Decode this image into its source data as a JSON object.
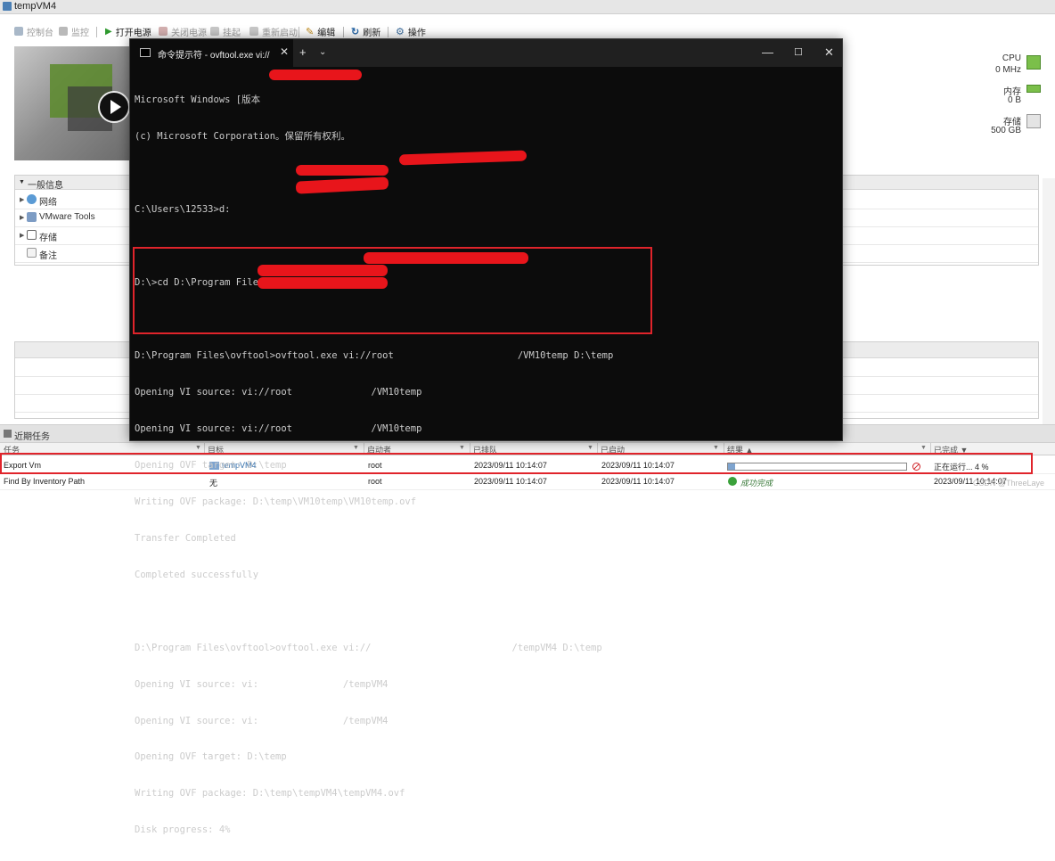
{
  "window": {
    "title": "tempVM4"
  },
  "toolbar": {
    "console": "控制台",
    "monitor": "监控",
    "power_on": "打开电源",
    "power_off": "关闭电源",
    "suspend": "挂起",
    "restart": "重新启动",
    "edit": "编辑",
    "refresh": "刷新",
    "actions": "操作"
  },
  "stats": {
    "cpu_label": "CPU",
    "cpu_value": "0 MHz",
    "mem_label": "内存",
    "mem_value": "0 B",
    "storage_label": "存储",
    "storage_value": "500 GB"
  },
  "general_info": {
    "title": "一般信息",
    "items": [
      {
        "label": "网络",
        "icon": "network-icon",
        "expandable": true
      },
      {
        "label": "VMware Tools",
        "icon": "vmware-tools-icon",
        "expandable": true
      },
      {
        "label": "存储",
        "icon": "storage-icon",
        "expandable": true
      },
      {
        "label": "备注",
        "icon": "notes-icon",
        "expandable": false
      }
    ]
  },
  "cmd": {
    "tab_title": "命令提示符 - ovftool.exe  vi://",
    "lines": [
      "Microsoft Windows [版本",
      "(c) Microsoft Corporation。保留所有权利。",
      "",
      "C:\\Users\\12533>d:",
      "",
      "D:\\>cd D:\\Program Files\\ovftool",
      "",
      "D:\\Program Files\\ovftool>ovftool.exe vi://root                      /VM10temp D:\\temp",
      "Opening VI source: vi://root              /VM10temp",
      "Opening VI source: vi://root              /VM10temp",
      "Opening OVF target: D:\\temp",
      "Writing OVF package: D:\\temp\\VM10temp\\VM10temp.ovf",
      "Transfer Completed",
      "Completed successfully",
      "",
      "D:\\Program Files\\ovftool>ovftool.exe vi://                         /tempVM4 D:\\temp",
      "Opening VI source: vi:               /tempVM4",
      "Opening VI source: vi:               /tempVM4",
      "Opening OVF target: D:\\temp",
      "Writing OVF package: D:\\temp\\tempVM4\\tempVM4.ovf",
      "Disk progress: 4%"
    ]
  },
  "recent_tasks": {
    "title": "近期任务",
    "columns": [
      "任务",
      "目标",
      "启动者",
      "已排队",
      "已启动",
      "结果 ▲",
      "已完成 ▼"
    ],
    "rows": [
      {
        "task": "Export Vm",
        "target": "tempVM4",
        "initiator": "root",
        "queued": "2023/09/11 10:14:07",
        "started": "2023/09/11 10:14:07",
        "result_progress": 4,
        "completed": "正在运行... 4 %"
      },
      {
        "task": "Find By Inventory Path",
        "target": "无",
        "initiator": "root",
        "queued": "2023/09/11 10:14:07",
        "started": "2023/09/11 10:14:07",
        "result": "成功完成",
        "completed": "2023/09/11 10:14:07"
      }
    ]
  },
  "watermark": "CSDN @ThreeLaye"
}
